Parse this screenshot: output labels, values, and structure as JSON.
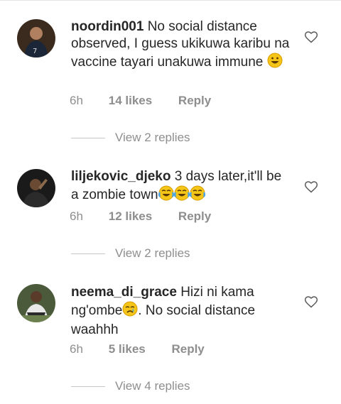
{
  "comments": [
    {
      "username": "noordin001",
      "text": "No social distance observed, I guess ukikuwa karibu na vaccine tayari unakuwa immune",
      "emoji": "grinning-emoji",
      "time": "6h",
      "likes": "14 likes",
      "reply": "Reply",
      "view_replies": "View 2 replies"
    },
    {
      "username": "liljekovic_djeko",
      "text": "3 days later,it'll be a zombie town",
      "emoji": "tears-of-joy-emoji x3",
      "time": "6h",
      "likes": "12 likes",
      "reply": "Reply",
      "view_replies": "View 2 replies"
    },
    {
      "username": "neema_di_grace",
      "text_a": "Hizi ni kama ng'ombe",
      "text_b": ". No social distance waahhh",
      "emoji": "crying-face-emoji",
      "time": "6h",
      "likes": "5 likes",
      "reply": "Reply",
      "view_replies": "View 4 replies"
    }
  ],
  "colors": {
    "text": "#262626",
    "muted": "#8e8e8e",
    "emoji": "#f5c518"
  },
  "icons": [
    "heart-outline-icon",
    "avatar"
  ]
}
